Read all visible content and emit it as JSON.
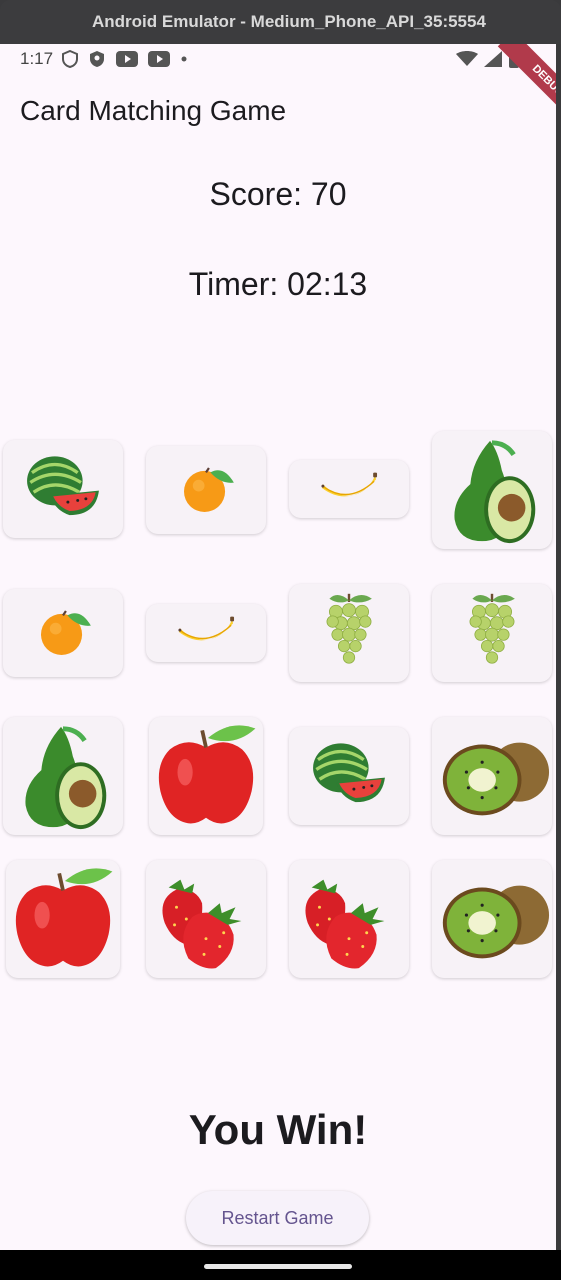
{
  "window": {
    "title": "Android Emulator - Medium_Phone_API_35:5554"
  },
  "status_bar": {
    "time": "1:17",
    "debug_banner": "DEBUG"
  },
  "app": {
    "title": "Card Matching Game"
  },
  "game": {
    "score_text": "Score: 70",
    "timer_text": "Timer: 02:13",
    "result_text": "You Win!",
    "restart_label": "Restart Game"
  },
  "cards": [
    "watermelon",
    "orange",
    "banana",
    "avocado",
    "orange",
    "banana",
    "grapes",
    "grapes",
    "avocado",
    "apple",
    "watermelon",
    "kiwi",
    "apple",
    "strawberry",
    "strawberry",
    "kiwi"
  ],
  "colors": {
    "background": "#fdf7fd",
    "accent": "#65558f"
  }
}
